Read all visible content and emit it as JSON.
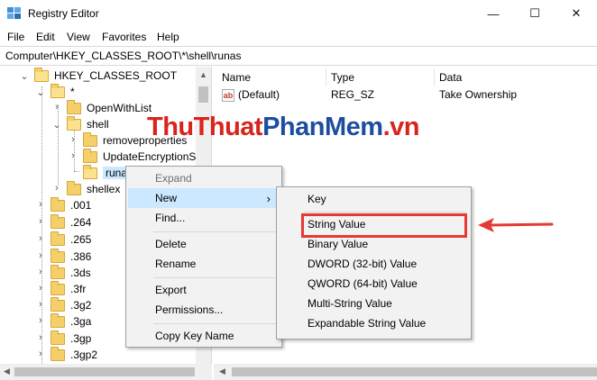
{
  "window": {
    "title": "Registry Editor"
  },
  "title_controls": {
    "minimize": "—",
    "maximize": "☐",
    "close": "✕"
  },
  "menubar": [
    "File",
    "Edit",
    "View",
    "Favorites",
    "Help"
  ],
  "address": "Computer\\HKEY_CLASSES_ROOT\\*\\shell\\runas",
  "tree": {
    "root": "HKEY_CLASSES_ROOT",
    "star": "*",
    "openwithlist": "OpenWithList",
    "shell": "shell",
    "removeproperties": "removeproperties",
    "updateencryption": "UpdateEncryptionSet",
    "runas": "runas",
    "shellex": "shellex",
    "extensions": [
      ".001",
      ".264",
      ".265",
      ".386",
      ".3ds",
      ".3fr",
      ".3g2",
      ".3ga",
      ".3gp",
      ".3gp2"
    ]
  },
  "list": {
    "headers": {
      "name": "Name",
      "type": "Type",
      "data": "Data"
    },
    "rows": [
      {
        "name": "(Default)",
        "type": "REG_SZ",
        "data": "Take Ownership",
        "icon": "ab"
      }
    ]
  },
  "watermark": {
    "part1": "ThuThuat",
    "part2": "PhanMem",
    "part3": ".vn"
  },
  "context_menu": {
    "items": [
      "Expand",
      "New",
      "Find...",
      "Delete",
      "Rename",
      "Export",
      "Permissions...",
      "Copy Key Name"
    ],
    "submenu_arrow": "›"
  },
  "new_submenu": {
    "items": [
      "Key",
      "String Value",
      "Binary Value",
      "DWORD (32-bit) Value",
      "QWORD (64-bit) Value",
      "Multi-String Value",
      "Expandable String Value"
    ]
  },
  "colors": {
    "highlight": "#cce8ff",
    "annotation_red": "#e53935",
    "folder": "#f5d06a"
  }
}
